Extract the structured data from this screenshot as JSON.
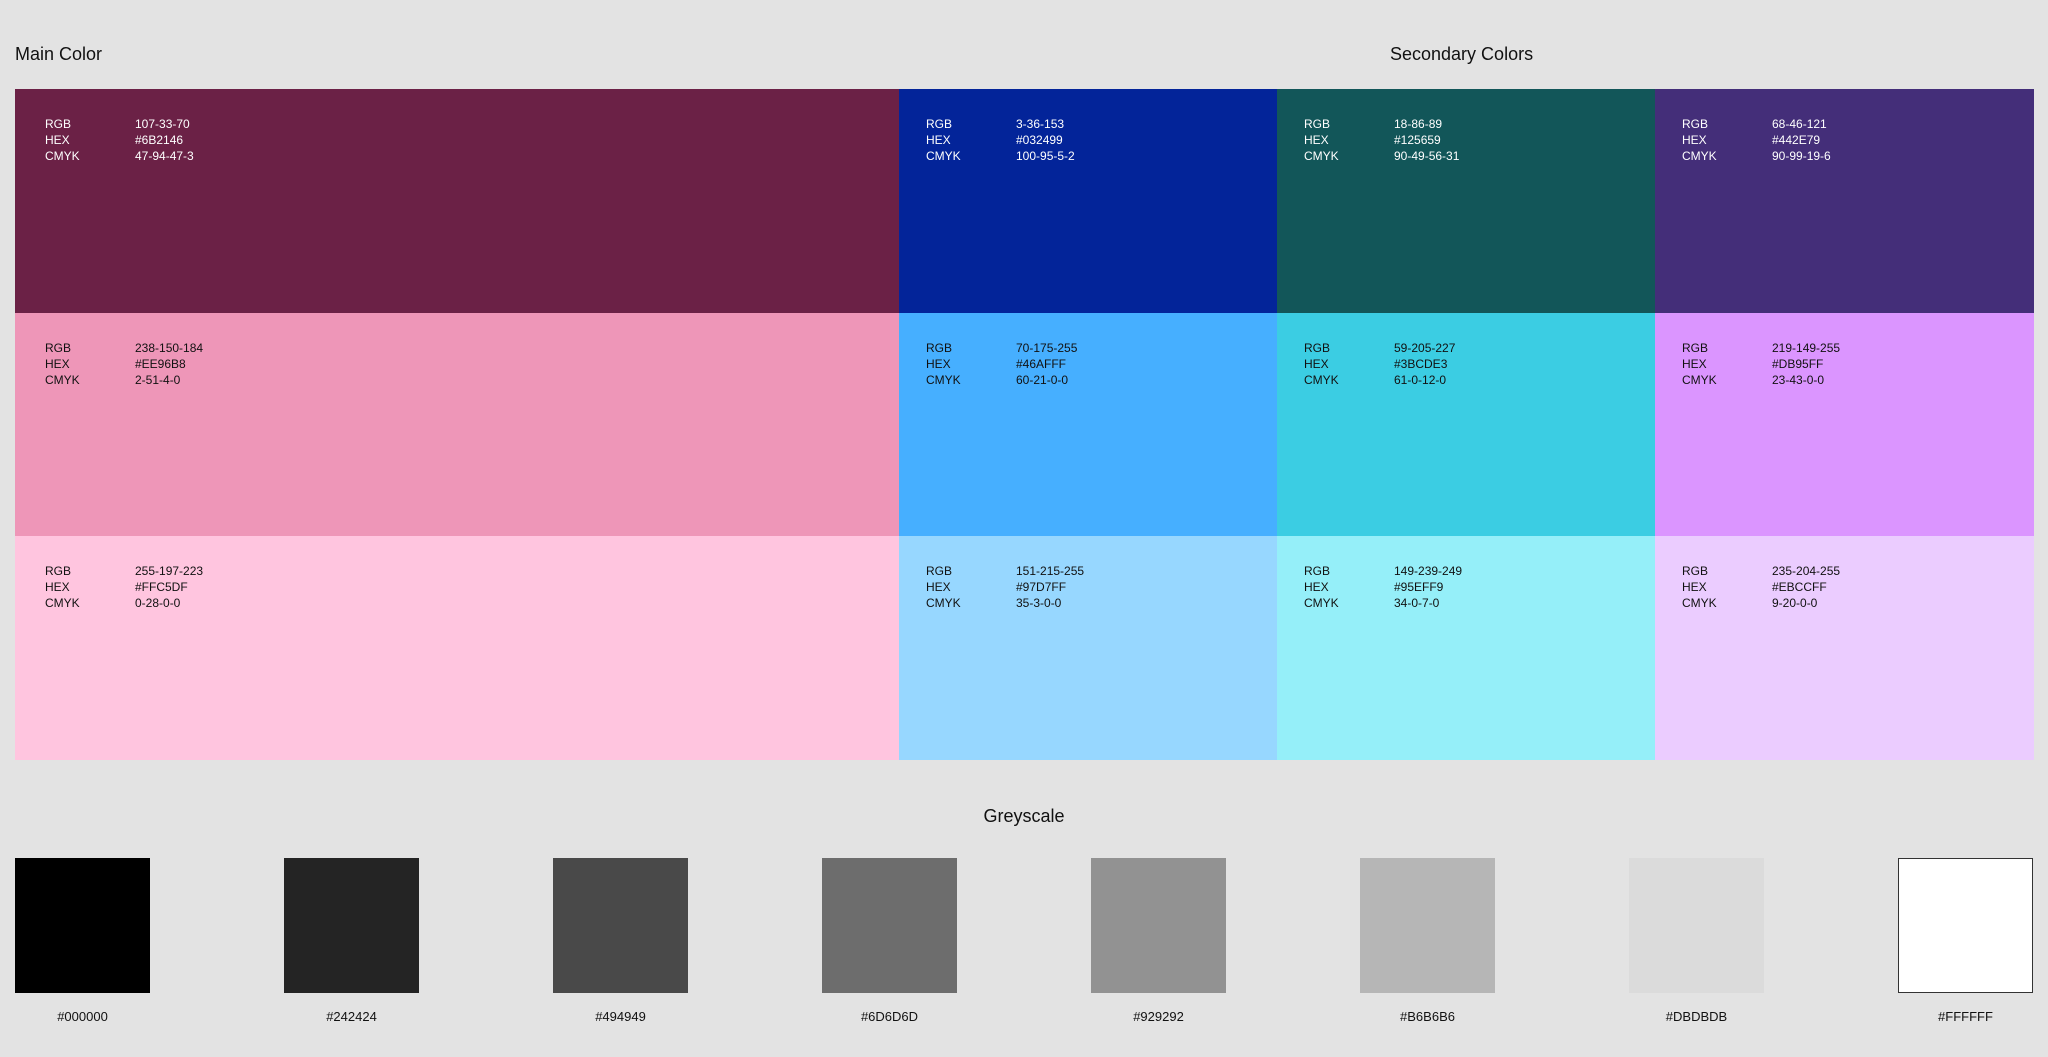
{
  "headings": {
    "main": "Main Color",
    "secondary": "Secondary Colors",
    "greyscale": "Greyscale"
  },
  "labels": {
    "rgb": "RGB",
    "hex": "HEX",
    "cmyk": "CMYK"
  },
  "columns": [
    {
      "swatches": [
        {
          "rgb": "107-33-70",
          "hex": "#6B2146",
          "cmyk": "47-94-47-3",
          "color": "#6B2146",
          "text": "light"
        },
        {
          "rgb": "238-150-184",
          "hex": "#EE96B8",
          "cmyk": "2-51-4-0",
          "color": "#EE96B8",
          "text": "dark"
        },
        {
          "rgb": "255-197-223",
          "hex": "#FFC5DF",
          "cmyk": "0-28-0-0",
          "color": "#FFC5DF",
          "text": "dark"
        }
      ]
    },
    {
      "swatches": [
        {
          "rgb": "3-36-153",
          "hex": "#032499",
          "cmyk": "100-95-5-2",
          "color": "#032499",
          "text": "light"
        },
        {
          "rgb": "70-175-255",
          "hex": "#46AFFF",
          "cmyk": "60-21-0-0",
          "color": "#46AFFF",
          "text": "dark"
        },
        {
          "rgb": "151-215-255",
          "hex": "#97D7FF",
          "cmyk": "35-3-0-0",
          "color": "#97D7FF",
          "text": "dark"
        }
      ]
    },
    {
      "swatches": [
        {
          "rgb": "18-86-89",
          "hex": "#125659",
          "cmyk": "90-49-56-31",
          "color": "#125659",
          "text": "light"
        },
        {
          "rgb": "59-205-227",
          "hex": "#3BCDE3",
          "cmyk": "61-0-12-0",
          "color": "#3BCDE3",
          "text": "dark"
        },
        {
          "rgb": "149-239-249",
          "hex": "#95EFF9",
          "cmyk": "34-0-7-0",
          "color": "#95EFF9",
          "text": "dark"
        }
      ]
    },
    {
      "swatches": [
        {
          "rgb": "68-46-121",
          "hex": "#442E79",
          "cmyk": "90-99-19-6",
          "color": "#442E79",
          "text": "light"
        },
        {
          "rgb": "219-149-255",
          "hex": "#DB95FF",
          "cmyk": "23-43-0-0",
          "color": "#DB95FF",
          "text": "dark"
        },
        {
          "rgb": "235-204-255",
          "hex": "#EBCCFF",
          "cmyk": "9-20-0-0",
          "color": "#EBCCFF",
          "text": "dark"
        }
      ]
    }
  ],
  "greys": [
    {
      "hex": "#000000"
    },
    {
      "hex": "#242424"
    },
    {
      "hex": "#494949"
    },
    {
      "hex": "#6D6D6D"
    },
    {
      "hex": "#929292"
    },
    {
      "hex": "#B6B6B6"
    },
    {
      "hex": "#DBDBDB"
    },
    {
      "hex": "#FFFFFF"
    }
  ]
}
